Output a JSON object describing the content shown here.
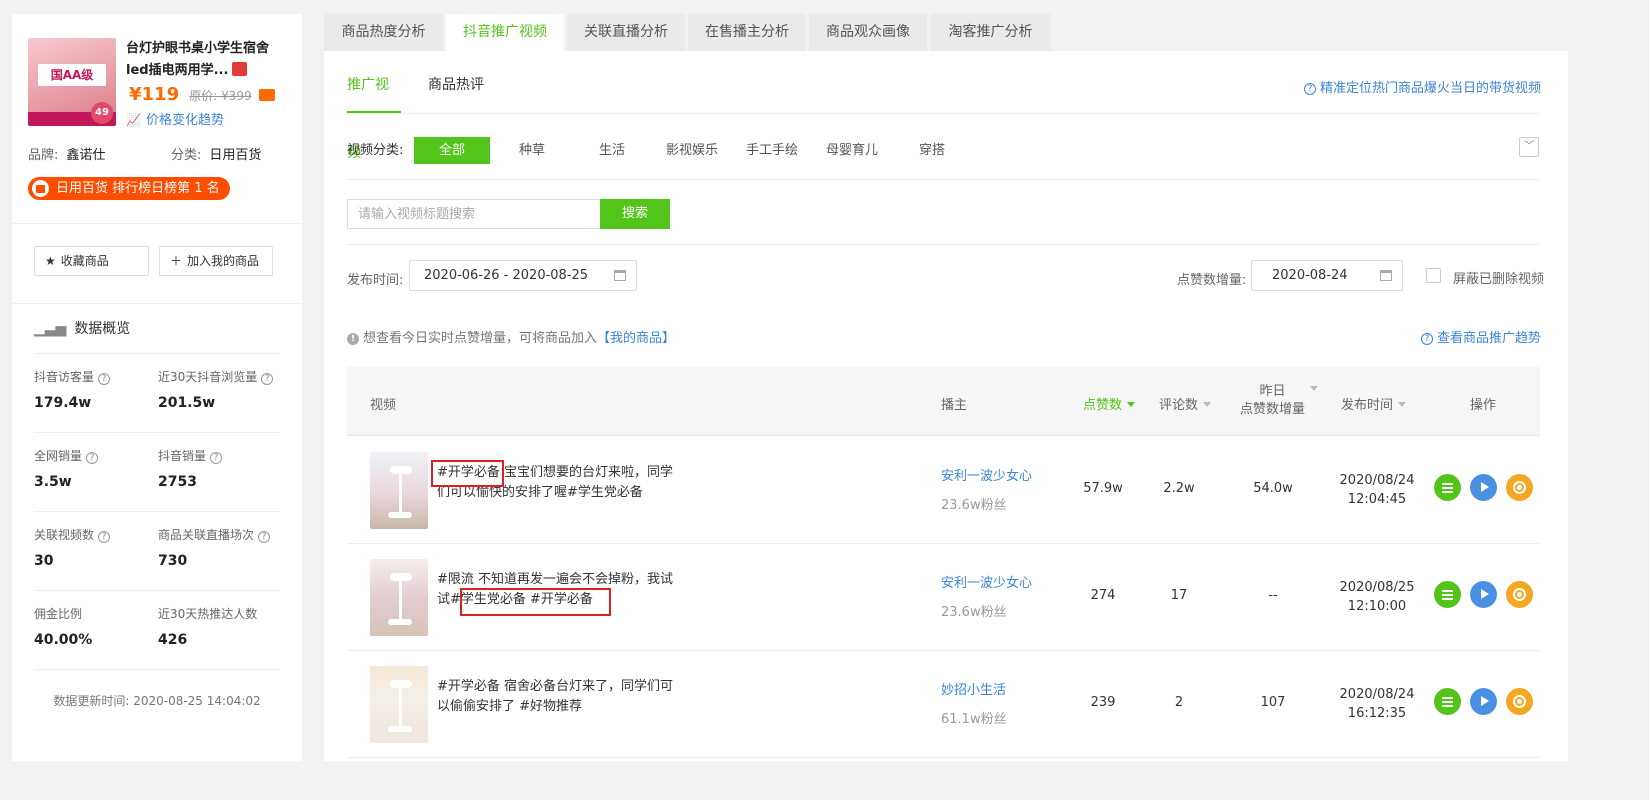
{
  "product": {
    "image_text": "国AA级",
    "badge_number": "49",
    "title": "台灯护眼书桌小学生宿舍led插电两用学...",
    "price": "¥119",
    "original_price": "原价: ¥399",
    "price_trend_label": "价格变化趋势",
    "brand_label": "品牌:",
    "brand_value": "鑫诺仕",
    "category_label": "分类:",
    "category_value": "日用百货",
    "rank_text": "日用百货 排行榜日榜第 1 名"
  },
  "actions": {
    "favorite_label": "收藏商品",
    "add_label": "加入我的商品"
  },
  "overview": {
    "title": "数据概览",
    "stats": [
      {
        "label": "抖音访客量",
        "value": "179.4w"
      },
      {
        "label": "近30天抖音浏览量",
        "value": "201.5w"
      },
      {
        "label": "全网销量",
        "value": "3.5w"
      },
      {
        "label": "抖音销量",
        "value": "2753"
      },
      {
        "label": "关联视频数",
        "value": "30"
      },
      {
        "label": "商品关联直播场次",
        "value": "730"
      },
      {
        "label": "佣金比例",
        "value": "40.00%"
      },
      {
        "label": "近30天热推达人数",
        "value": "426"
      }
    ],
    "update_time": "数据更新时间: 2020-08-25 14:04:02"
  },
  "tabs": [
    "商品热度分析",
    "抖音推广视频",
    "关联直播分析",
    "在售播主分析",
    "商品观众画像",
    "淘客推广分析"
  ],
  "subtabs": [
    "推广视频",
    "商品热评"
  ],
  "help_link": "精准定位热门商品爆火当日的带货视频",
  "filters": {
    "category_label": "视频分类:",
    "categories": [
      "全部",
      "种草",
      "生活",
      "影视娱乐",
      "手工手绘",
      "母婴育儿",
      "穿搭"
    ],
    "search_placeholder": "请输入视频标题搜索",
    "search_button": "搜索",
    "publish_label": "发布时间:",
    "publish_range": "2020-06-26 - 2020-08-25",
    "likes_label": "点赞数增量:",
    "likes_date": "2020-08-24",
    "hide_deleted_label": "屏蔽已删除视频"
  },
  "tip": {
    "text": "想查看今日实时点赞增量，可将商品加入",
    "link": "【我的商品】",
    "trend_link": "查看商品推广趋势"
  },
  "table": {
    "headers": {
      "video": "视频",
      "anchor": "播主",
      "likes": "点赞数",
      "comments": "评论数",
      "yesterday_line1": "昨日",
      "yesterday_line2": "点赞数增量",
      "publish": "发布时间",
      "actions": "操作"
    },
    "rows": [
      {
        "title": "#开学必备 宝宝们想要的台灯来啦，同学们可以愉快的安排了喔#学生党必备",
        "anchor": "安利一波少女心",
        "fans": "23.6w粉丝",
        "likes": "57.9w",
        "comments": "2.2w",
        "yesterday": "54.0w",
        "date": "2020/08/24",
        "time": "12:04:45"
      },
      {
        "title": "#限流 不知道再发一遍会不会掉粉，我试试#学生党必备 #开学必备",
        "anchor": "安利一波少女心",
        "fans": "23.6w粉丝",
        "likes": "274",
        "comments": "17",
        "yesterday": "--",
        "date": "2020/08/25",
        "time": "12:10:00"
      },
      {
        "title": "#开学必备 宿舍必备台灯来了，同学们可以偷偷安排了 #好物推荐",
        "anchor": "妙招小生活",
        "fans": "61.1w粉丝",
        "likes": "239",
        "comments": "2",
        "yesterday": "107",
        "date": "2020/08/24",
        "time": "16:12:35"
      }
    ]
  },
  "colors": {
    "accent_green": "#52c41a",
    "link_blue": "#3b86d9",
    "price_orange": "#ff6a00",
    "highlight_red": "#e02020"
  }
}
